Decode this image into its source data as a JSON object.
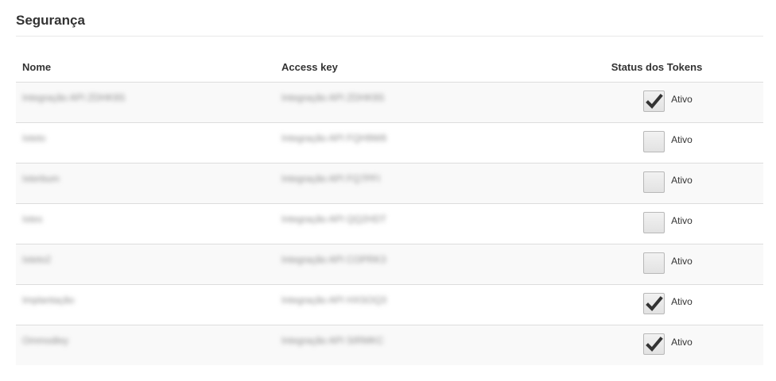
{
  "page": {
    "title": "Segurança"
  },
  "table": {
    "headers": {
      "name": "Nome",
      "key": "Access key",
      "status": "Status dos Tokens"
    },
    "rows": [
      {
        "name": "Integração API ZDHK9S",
        "key": "Integração API ZDHK9S",
        "status_label": "Ativo",
        "active": true
      },
      {
        "name": "Ixteto",
        "key": "Integração API FQH9W8",
        "status_label": "Ativo",
        "active": false
      },
      {
        "name": "Ixterbum",
        "key": "Integração API FQ7PFI",
        "status_label": "Ativo",
        "active": false
      },
      {
        "name": "Ixtes",
        "key": "Integração API QQ2HDT",
        "status_label": "Ativo",
        "active": false
      },
      {
        "name": "Ixteto2",
        "key": "Integração API COPRK3",
        "status_label": "Ativo",
        "active": false
      },
      {
        "name": "Implantação",
        "key": "Integração API HXSOQ3",
        "status_label": "Ativo",
        "active": true
      },
      {
        "name": "Ommodley",
        "key": "Integração API SIRMKC",
        "status_label": "Ativo",
        "active": true
      }
    ]
  },
  "colors": {
    "row_alt": "#f9f9f9",
    "border": "#dddddd",
    "check": "#333333"
  }
}
